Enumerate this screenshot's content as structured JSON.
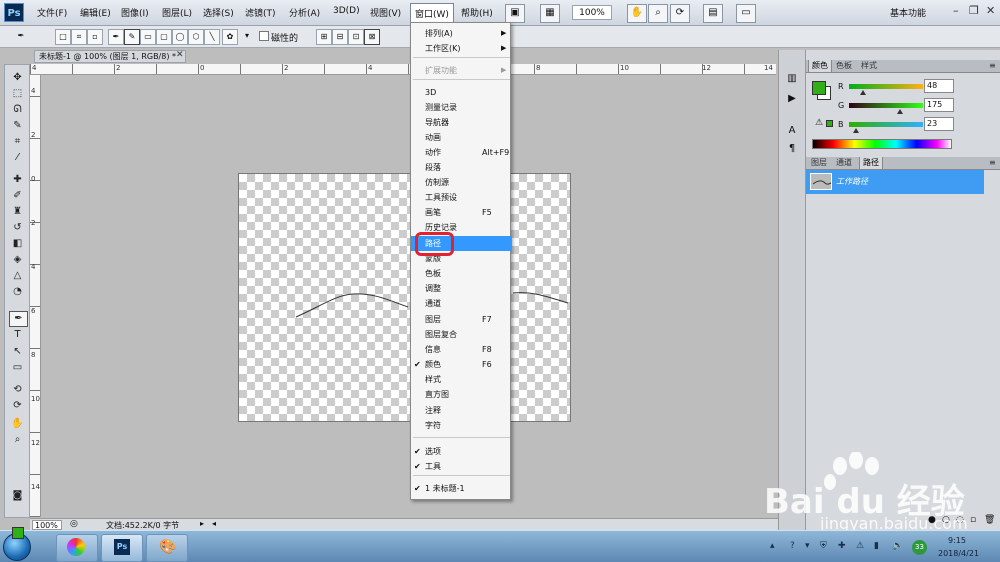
{
  "app": {
    "logo_text": "Ps"
  },
  "menubar": {
    "items": [
      "文件(F)",
      "编辑(E)",
      "图像(I)",
      "图层(L)",
      "选择(S)",
      "滤镜(T)",
      "分析(A)",
      "3D(D)",
      "视图(V)",
      "窗口(W)",
      "帮助(H)"
    ],
    "zoom": "100%",
    "workspace": "基本功能"
  },
  "options": {
    "magnetic_label": "磁性的"
  },
  "document": {
    "tab_title": "未标题-1 @ 100% (图层 1, RGB/8) *",
    "zoom_status": "100%",
    "doc_info": "文档:452.2K/0 字节"
  },
  "ruler": {
    "top": [
      "4",
      "2",
      "0",
      "2",
      "4",
      "6",
      "8",
      "10",
      "12",
      "14"
    ],
    "left": [
      "4",
      "2",
      "0",
      "2",
      "4",
      "6",
      "8",
      "10",
      "12",
      "14"
    ]
  },
  "color_panel": {
    "tabs": [
      "颜色",
      "色板",
      "样式"
    ],
    "r_label": "R",
    "g_label": "G",
    "b_label": "B",
    "r": 48,
    "g": 175,
    "b": 23,
    "r_text": "48",
    "g_text": "175",
    "b_text": "23"
  },
  "layers_panel": {
    "tabs": [
      "图层",
      "通道",
      "路径"
    ],
    "path_name": "工作路径"
  },
  "window_menu": {
    "items": [
      {
        "label": "排列(A)",
        "submenu": true
      },
      {
        "label": "工作区(K)",
        "submenu": true
      },
      {
        "label": "扩展功能",
        "submenu": true,
        "disabled": true
      },
      {
        "label": "3D"
      },
      {
        "label": "测量记录"
      },
      {
        "label": "导航器"
      },
      {
        "label": "动画"
      },
      {
        "label": "动作",
        "shortcut": "Alt+F9"
      },
      {
        "label": "段落"
      },
      {
        "label": "仿制源"
      },
      {
        "label": "工具预设"
      },
      {
        "label": "画笔",
        "shortcut": "F5"
      },
      {
        "label": "历史记录"
      },
      {
        "label": "路径",
        "highlighted": true
      },
      {
        "label": "蒙版"
      },
      {
        "label": "色板"
      },
      {
        "label": "调整"
      },
      {
        "label": "通道"
      },
      {
        "label": "图层",
        "shortcut": "F7"
      },
      {
        "label": "图层复合"
      },
      {
        "label": "信息",
        "shortcut": "F8"
      },
      {
        "label": "颜色",
        "shortcut": "F6",
        "checked": true
      },
      {
        "label": "样式"
      },
      {
        "label": "直方图"
      },
      {
        "label": "注释"
      },
      {
        "label": "字符"
      },
      {
        "label": "选项",
        "checked": true
      },
      {
        "label": "工具",
        "checked": true
      },
      {
        "label": "1 未标题-1",
        "checked": true
      }
    ]
  },
  "taskbar": {
    "time": "9:15",
    "date": "2018/4/21",
    "tray_badge": "33"
  },
  "watermark": {
    "text": "Bai du 经验",
    "url": "jingyan.baidu.com"
  },
  "colors": {
    "accent": "#3399ff",
    "highlight_ring": "#e0232e",
    "foreground": "#30af17"
  }
}
